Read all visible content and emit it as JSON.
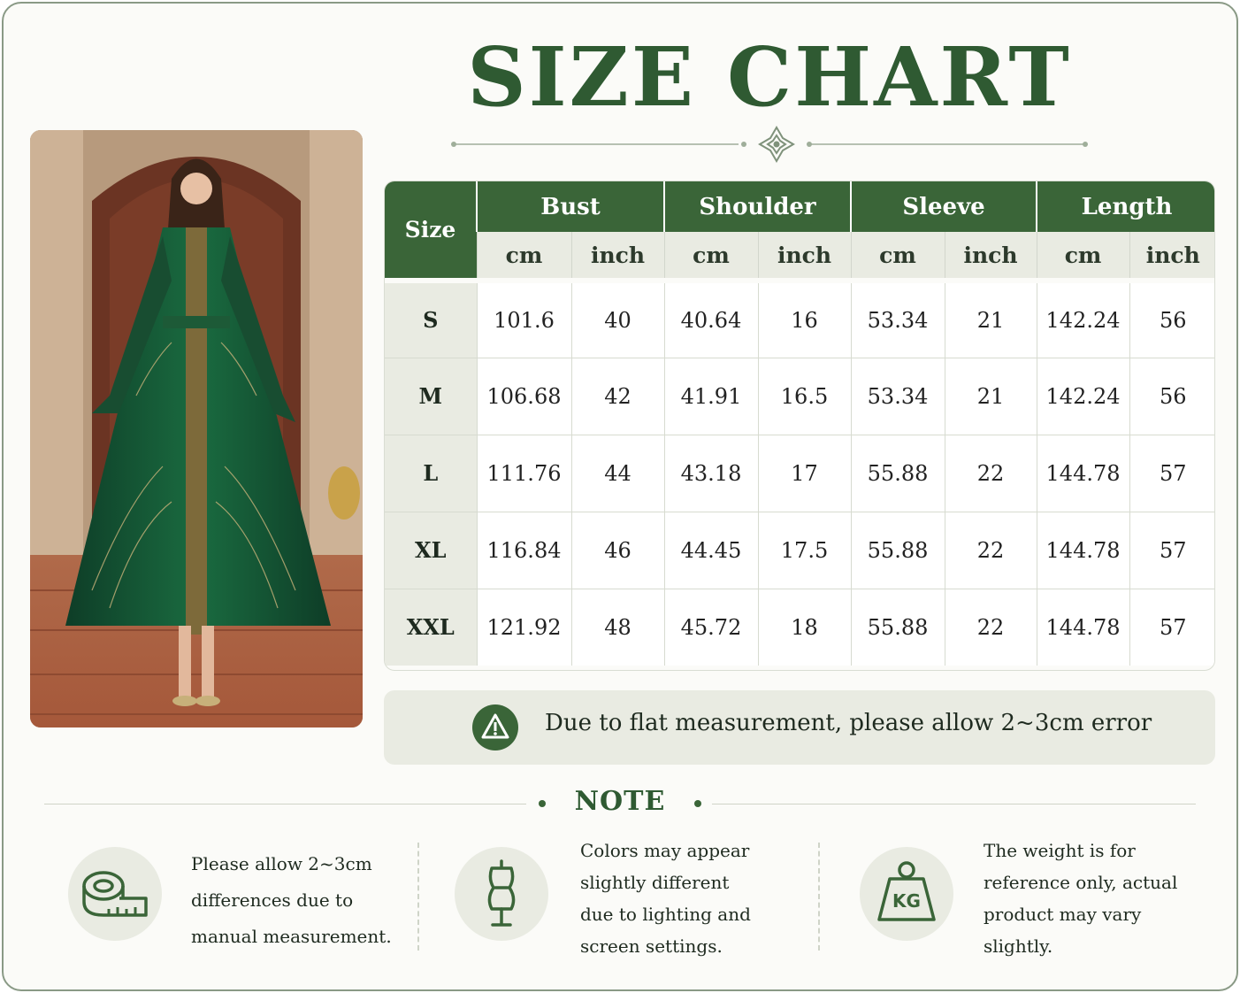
{
  "header": {
    "title": "SIZE CHART"
  },
  "photo": {
    "alt": "Model wearing green embroidered long dress"
  },
  "table": {
    "size_header": "Size",
    "groups": [
      {
        "name": "Bust",
        "units": [
          "cm",
          "inch"
        ]
      },
      {
        "name": "Shoulder",
        "units": [
          "cm",
          "inch"
        ]
      },
      {
        "name": "Sleeve",
        "units": [
          "cm",
          "inch"
        ]
      },
      {
        "name": "Length",
        "units": [
          "cm",
          "inch"
        ]
      }
    ],
    "rows": [
      {
        "size": "S",
        "values": [
          "101.6",
          "40",
          "40.64",
          "16",
          "53.34",
          "21",
          "142.24",
          "56"
        ]
      },
      {
        "size": "M",
        "values": [
          "106.68",
          "42",
          "41.91",
          "16.5",
          "53.34",
          "21",
          "142.24",
          "56"
        ]
      },
      {
        "size": "L",
        "values": [
          "111.76",
          "44",
          "43.18",
          "17",
          "55.88",
          "22",
          "144.78",
          "57"
        ]
      },
      {
        "size": "XL",
        "values": [
          "116.84",
          "46",
          "44.45",
          "17.5",
          "55.88",
          "22",
          "144.78",
          "57"
        ]
      },
      {
        "size": "XXL",
        "values": [
          "121.92",
          "48",
          "45.72",
          "18",
          "55.88",
          "22",
          "144.78",
          "57"
        ]
      }
    ]
  },
  "notice": {
    "icon": "warning-icon",
    "text": "Due to flat measurement, please allow 2~3cm error"
  },
  "note": {
    "title": "NOTE",
    "items": [
      {
        "icon": "measuring-tape-icon",
        "lines": [
          "Please allow 2~3cm",
          "differences due to",
          "manual measurement."
        ]
      },
      {
        "icon": "mannequin-icon",
        "lines": [
          "Colors may appear",
          "slightly different",
          "due to lighting and",
          "screen settings."
        ]
      },
      {
        "icon": "weight-kg-icon",
        "icon_text": "KG",
        "lines": [
          "The weight is for",
          "reference only, actual",
          "product may vary",
          "slightly."
        ]
      }
    ]
  },
  "colors": {
    "primary_green": "#3a6538",
    "light_sage": "#e9ebe2",
    "title_green": "#2f5a32"
  }
}
